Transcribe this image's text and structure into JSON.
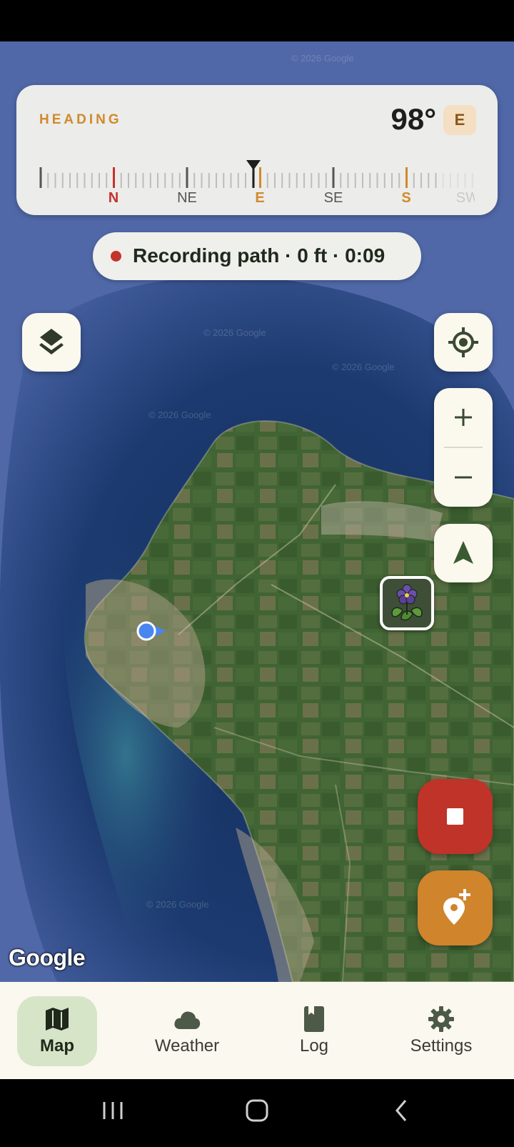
{
  "heading": {
    "label": "HEADING",
    "degrees": "98°",
    "direction": "E",
    "compass_ticks": [
      "N",
      "NE",
      "E",
      "SE",
      "S",
      "SW"
    ]
  },
  "recording": {
    "text": "Recording path · 0 ft · 0:09"
  },
  "map": {
    "attribution": "Google",
    "watermark": "© 2026 Google"
  },
  "icons": {
    "layers": "layers-icon",
    "locate": "my-location-icon",
    "zoom_in": "plus-icon",
    "zoom_out": "minus-icon",
    "compass": "navigation-arrow-icon",
    "plant": "violet-flower-icon",
    "stop": "stop-icon",
    "add_pin": "add-location-icon"
  },
  "colors": {
    "accent": "#d0842c",
    "record_red": "#bf3329",
    "nav_active": "#d6e5c7"
  },
  "bottom_nav": {
    "items": [
      {
        "label": "Map",
        "icon": "map-icon",
        "active": true
      },
      {
        "label": "Weather",
        "icon": "cloud-icon",
        "active": false
      },
      {
        "label": "Log",
        "icon": "book-icon",
        "active": false
      },
      {
        "label": "Settings",
        "icon": "gear-icon",
        "active": false
      }
    ]
  }
}
